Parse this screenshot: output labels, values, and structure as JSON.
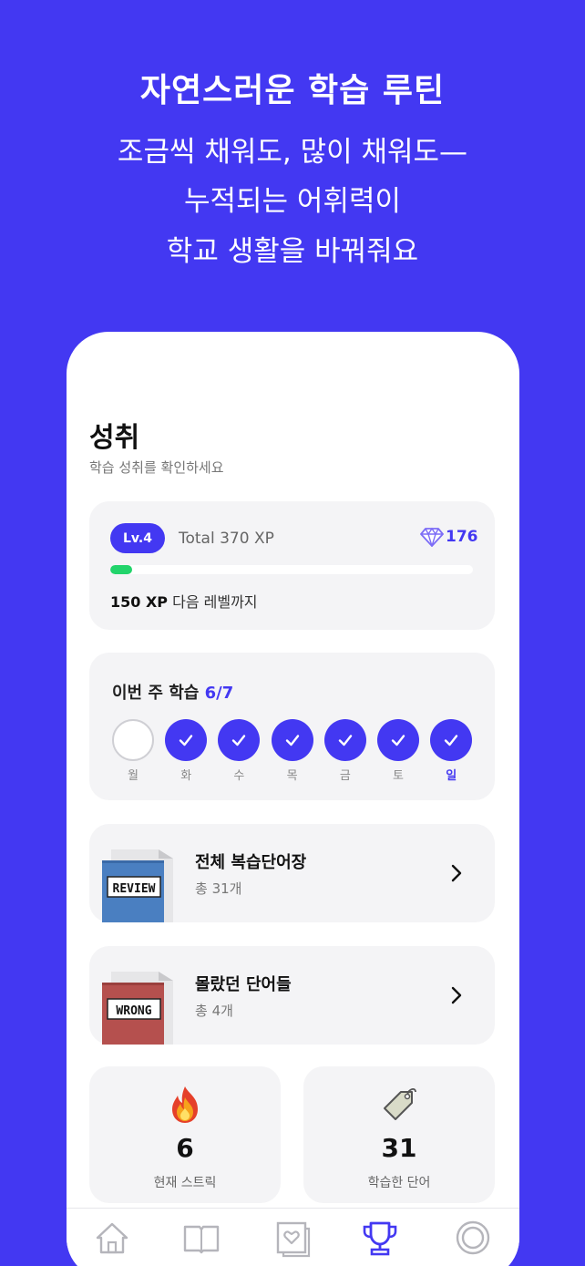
{
  "hero": {
    "title": "자연스러운 학습 루틴",
    "line1": "조금씩 채워도, 많이 채워도—",
    "line2": "누적되는 어휘력이",
    "line3": "학교 생활을 바꿔줘요"
  },
  "page": {
    "title": "성취",
    "subtitle": "학습 성취를 확인하세요"
  },
  "level": {
    "badge": "Lv.4",
    "total": "Total 370 XP",
    "gems": "176",
    "progress": 0.06,
    "next_value": "150 XP",
    "next_text": " 다음 레벨까지",
    "progress_color": "#22D46B"
  },
  "week": {
    "label": "이번 주 학습",
    "count": "6/7",
    "days": [
      {
        "label": "월",
        "done": false
      },
      {
        "label": "화",
        "done": true
      },
      {
        "label": "수",
        "done": true
      },
      {
        "label": "목",
        "done": true
      },
      {
        "label": "금",
        "done": true
      },
      {
        "label": "토",
        "done": true
      },
      {
        "label": "일",
        "done": true
      }
    ]
  },
  "lists": [
    {
      "title": "전체 복습단어장",
      "sub": "총 31개",
      "art_text": "REVIEW",
      "icon": "review-book-icon",
      "color": "#4A7FC1"
    },
    {
      "title": "몰랐던 단어들",
      "sub": "총 4개",
      "art_text": "WRONG",
      "icon": "wrong-book-icon",
      "color": "#B5504E"
    }
  ],
  "stats": [
    {
      "value": "6",
      "label": "현재 스트릭",
      "icon": "fire-icon"
    },
    {
      "value": "31",
      "label": "학습한 단어",
      "icon": "tag-icon"
    }
  ],
  "tabs": [
    {
      "icon": "home-icon",
      "active": false
    },
    {
      "icon": "book-icon",
      "active": false
    },
    {
      "icon": "heart-card-icon",
      "active": false
    },
    {
      "icon": "trophy-icon",
      "active": true
    },
    {
      "icon": "ring-icon",
      "active": false
    }
  ],
  "colors": {
    "brand": "#4338F2",
    "card": "#F4F4F6"
  }
}
